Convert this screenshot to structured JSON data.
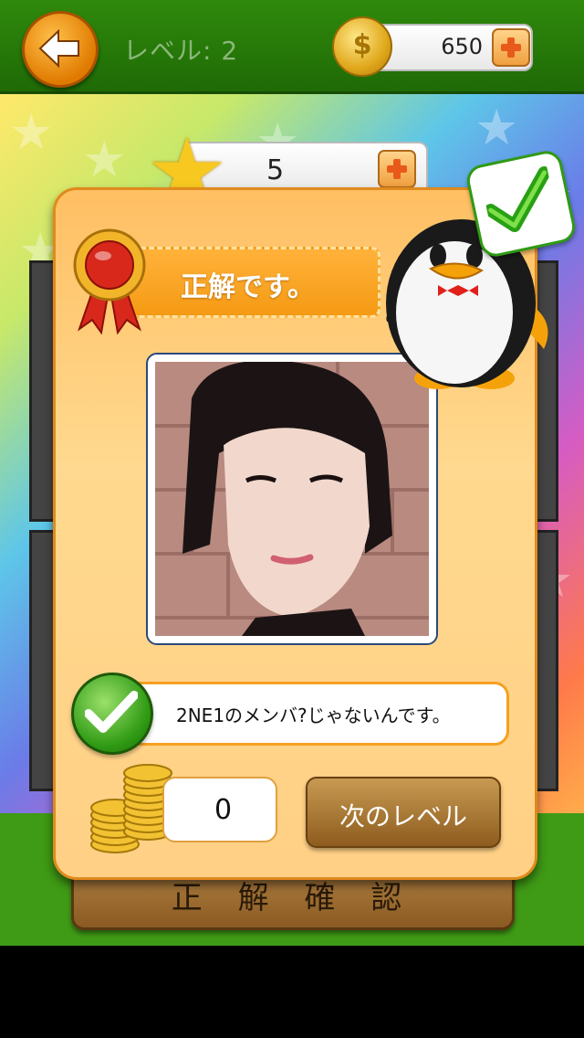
{
  "header": {
    "level_label": "レベル: 2",
    "coins": "650"
  },
  "board": {
    "hints": "5",
    "confirm_label": "正 解 確 認"
  },
  "dialog": {
    "title": "正解です。",
    "answer_text": "2NE1のメンバ?じゃないんです。",
    "reward_coins": "0",
    "next_button": "次のレベル"
  },
  "icons": {
    "back": "arrow-left-icon",
    "coin": "coin-icon",
    "add": "plus-icon",
    "star": "star-icon",
    "medal": "medal-icon",
    "check": "check-icon",
    "penguin": "penguin-mascot",
    "coin_stack": "coin-stack-icon"
  },
  "colors": {
    "topbar": "#2f8a0c",
    "dialog": "#ffd085",
    "accent": "#f59a14",
    "success": "#2f9a14"
  }
}
